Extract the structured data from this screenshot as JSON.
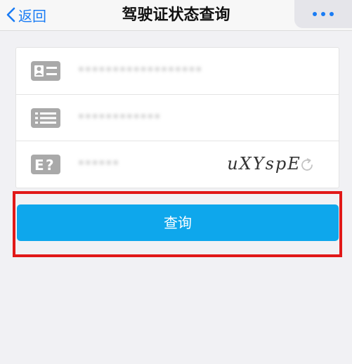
{
  "nav": {
    "back_label": "返回",
    "title": "驾驶证状态查询",
    "accent_color": "#1a7cf4"
  },
  "form": {
    "rows": [
      {
        "icon": "id-card-icon",
        "value": "••••••••••••••••••"
      },
      {
        "icon": "list-icon",
        "value": "••••••••••••"
      },
      {
        "icon": "captcha-icon",
        "value": "••••••"
      }
    ],
    "captcha_text": "uXYspE"
  },
  "query_button": {
    "label": "查询",
    "color": "#0ea7ec",
    "highlight_color": "#e11818"
  }
}
